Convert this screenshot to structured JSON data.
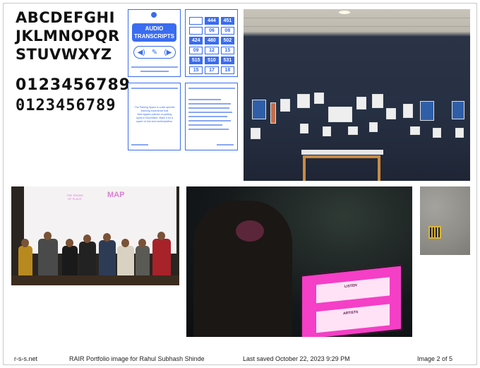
{
  "specimen": {
    "lines": [
      "ABCDEFGHI",
      "JKLMNOPQR",
      "STUVWXYZ"
    ],
    "numbers": [
      "0123456789",
      "0123456789"
    ]
  },
  "posters": {
    "p1": {
      "title_line1": "AUDIO",
      "title_line2": "TRANSCRIPTS"
    },
    "p2": {
      "cells": [
        "",
        "444",
        "451",
        "",
        "06",
        "08",
        "424",
        "480",
        "502",
        "09",
        "12",
        "15",
        "515",
        "510",
        "531",
        "15",
        "17",
        "18"
      ]
    },
    "p3": {
      "text": "The Parking Space is a site-specific listening experience that interrogates policies of parking spots in Bloomfield. Make it for a space of rest and contemplation."
    }
  },
  "footer": {
    "site": "r-s-s.net",
    "description": "RAIR Portfolio image for Rahul Subhash Shinde",
    "saved": "Last saved October 22, 2023 9:29 PM",
    "page": "Image 2 of 5"
  },
  "presentation": {
    "screen_title": "MAP",
    "screen_subtitle": "THE SOUND OF PLACE"
  },
  "laptop": {
    "listen_label": "LISTEN",
    "artists_label": "ARTISTS"
  },
  "colors": {
    "poster_blue": "#3a6cf0",
    "laptop_pink": "#f43fc6",
    "frame_wood": "#c98b44"
  }
}
